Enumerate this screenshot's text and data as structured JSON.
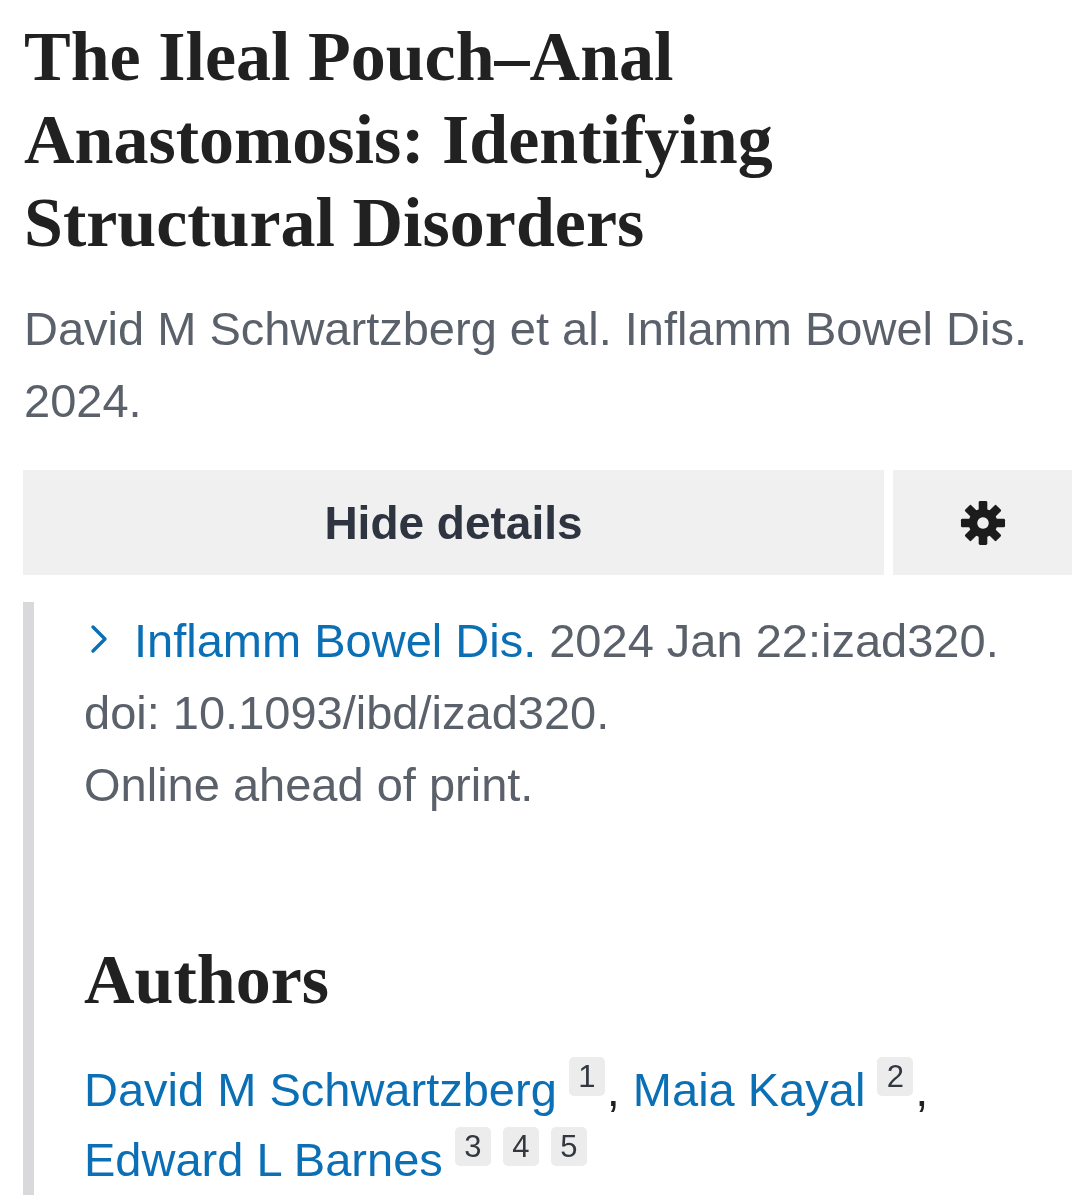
{
  "article": {
    "title": "The Ileal Pouch–Anal Anastomosis: Identifying Structural Disorders",
    "citation": "David M Schwartzberg et al. Inflamm Bowel Dis. 2024."
  },
  "actions": {
    "details_toggle": {
      "label": "Hide details",
      "expanded": true
    }
  },
  "details": {
    "journal": "Inflamm Bowel Dis.",
    "date_id": "2024 Jan 22:izad320.",
    "doi": "doi: 10.1093/ibd/izad320.",
    "status": "Online ahead of print.",
    "authors_heading": "Authors",
    "authors": [
      {
        "name": "David M Schwartzberg",
        "affiliations": [
          "1"
        ],
        "separator": ","
      },
      {
        "name": "Maia Kayal",
        "affiliations": [
          "2"
        ],
        "separator": ","
      },
      {
        "name": "Edward L Barnes",
        "affiliations": [
          "3",
          "4",
          "5"
        ]
      }
    ]
  }
}
